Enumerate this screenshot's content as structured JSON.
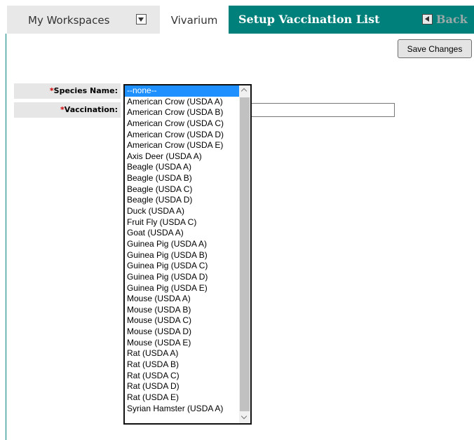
{
  "header": {
    "workspaces_label": "My Workspaces",
    "vivarium_label": "Vivarium",
    "page_title": "Setup Vaccination List",
    "back_label": "Back"
  },
  "toolbar": {
    "save_label": "Save Changes"
  },
  "form": {
    "species_label": "Species Name:",
    "vaccination_label": "Vaccination:",
    "required_marker": "*",
    "vaccination_value": ""
  },
  "species_options": [
    "--none--",
    "American Crow (USDA A)",
    "American Crow (USDA B)",
    "American Crow (USDA C)",
    "American Crow (USDA D)",
    "American Crow (USDA E)",
    "Axis Deer (USDA A)",
    "Beagle (USDA A)",
    "Beagle (USDA B)",
    "Beagle (USDA C)",
    "Beagle (USDA D)",
    "Duck (USDA A)",
    "Fruit Fly (USDA C)",
    "Goat (USDA A)",
    "Guinea Pig (USDA A)",
    "Guinea Pig (USDA B)",
    "Guinea Pig (USDA C)",
    "Guinea Pig (USDA D)",
    "Guinea Pig (USDA E)",
    "Mouse (USDA A)",
    "Mouse (USDA B)",
    "Mouse (USDA C)",
    "Mouse (USDA D)",
    "Mouse (USDA E)",
    "Rat (USDA A)",
    "Rat (USDA B)",
    "Rat (USDA C)",
    "Rat (USDA D)",
    "Rat (USDA E)",
    "Syrian Hamster (USDA A)"
  ],
  "selected_index": 0,
  "colors": {
    "accent": "#00807a",
    "selection": "#1e90ff",
    "required": "#d20000"
  },
  "icons": {
    "workspaces_dropdown": "dropdown-arrow-icon",
    "back": "back-arrow-icon"
  }
}
